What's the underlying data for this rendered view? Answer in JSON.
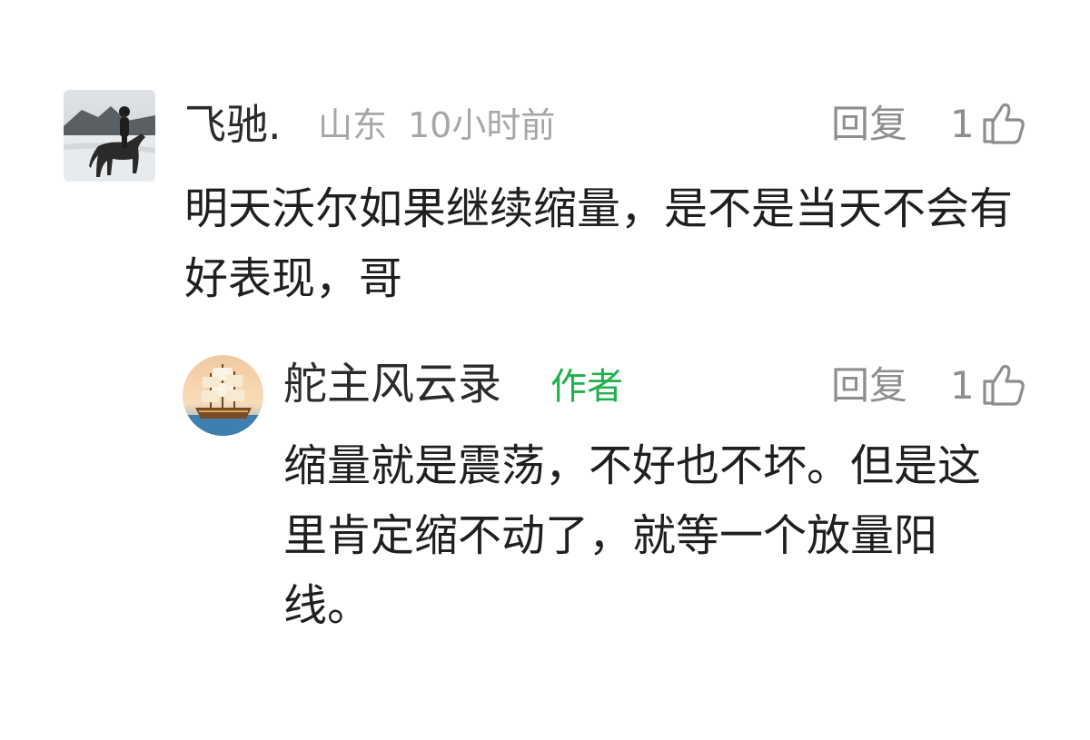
{
  "comments": [
    {
      "name": "飞驰.",
      "location": "山东",
      "time": "10小时前",
      "reply_label": "回复",
      "likes": "1",
      "text": "明天沃尔如果继续缩量，是不是当天不会有好表现，哥",
      "avatar_icon": "horse-rider-avatar"
    }
  ],
  "replies": [
    {
      "name": "舵主风云录",
      "badge": "作者",
      "reply_label": "回复",
      "likes": "1",
      "text": "缩量就是震荡，不好也不坏。但是这里肯定缩不动了，就等一个放量阳线。",
      "avatar_icon": "sailing-ship-avatar"
    }
  ],
  "colors": {
    "author_badge": "#20b14c",
    "meta": "#a6a6a6",
    "action": "#8e8e8e",
    "text": "#1f1f1f"
  }
}
